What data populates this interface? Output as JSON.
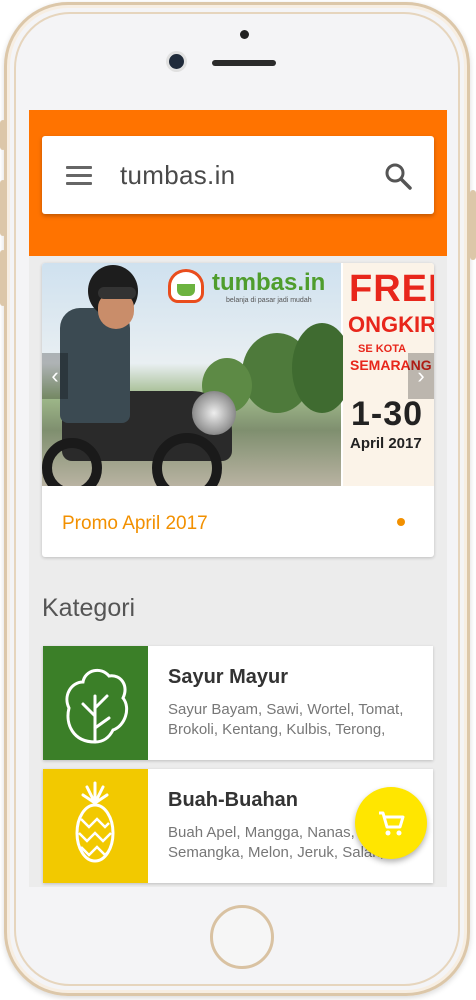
{
  "app": {
    "title": "tumbas.in"
  },
  "colors": {
    "appbar": "#ff7300",
    "accent": "#f29000",
    "vegetables": "#3b7f28",
    "fruits": "#f2c900",
    "fab": "#ffe600"
  },
  "header": {
    "menu_icon": "hamburger-menu-icon",
    "search_icon": "search-icon"
  },
  "banner": {
    "logo_text": "tumbas.in",
    "logo_tagline": "belanja di pasar jadi mudah",
    "slide2": {
      "line1": "FREE",
      "line2": "ONGKIR",
      "line3": "SE KOTA",
      "line4": "SEMARANG",
      "range": "1-30",
      "month": "April 2017"
    },
    "prev_arrow": "‹",
    "next_arrow": "›"
  },
  "promo": {
    "caption": "Promo April 2017"
  },
  "section": {
    "title": "Kategori"
  },
  "categories": [
    {
      "name": "Sayur Mayur",
      "description": "Sayur Bayam, Sawi, Wortel, Tomat, Brokoli, Kentang, Kulbis, Terong,",
      "icon": "lettuce-icon"
    },
    {
      "name": "Buah-Buahan",
      "description": "Buah Apel, Mangga, Nanas, Semangka, Melon, Jeruk, Salak,",
      "icon": "pineapple-icon"
    }
  ],
  "fab": {
    "icon": "shopping-cart-icon"
  }
}
